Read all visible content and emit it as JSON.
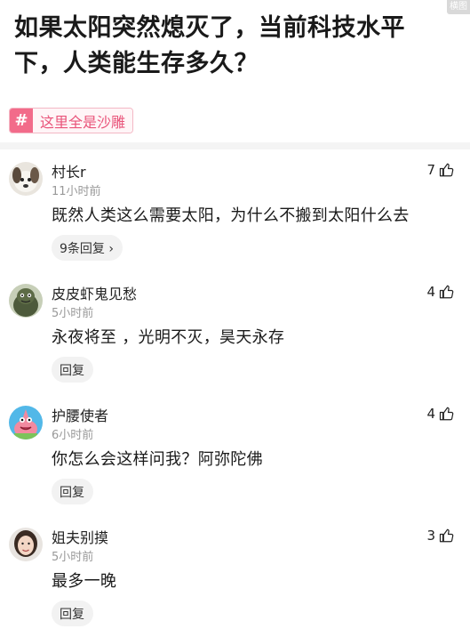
{
  "corner_tag": "横图",
  "post": {
    "title": "如果太阳突然熄灭了，当前科技水平下，人类能生存多久？",
    "topic": {
      "icon": "#",
      "label": "这里全是沙雕"
    }
  },
  "comments": [
    {
      "user": "村长r",
      "time": "11小时前",
      "content": "既然人类这么需要太阳，为什么不搬到太阳什么去",
      "likes": "7",
      "reply": "9条回复 ›",
      "avatar": "dog-avatar"
    },
    {
      "user": "皮皮虾鬼见愁",
      "time": "5小时前",
      "content": "永夜将至 ，光明不灭，昊天永存",
      "likes": "4",
      "reply": "回复",
      "avatar": "green-figure-avatar"
    },
    {
      "user": "护腰使者",
      "time": "6小时前",
      "content": "你怎么会这样问我？阿弥陀佛",
      "likes": "4",
      "reply": "回复",
      "avatar": "patrick-cartoon-avatar"
    },
    {
      "user": "姐夫别摸",
      "time": "5小时前",
      "content": "最多一晚",
      "likes": "3",
      "reply": "回复",
      "avatar": "girl-photo-avatar"
    }
  ]
}
